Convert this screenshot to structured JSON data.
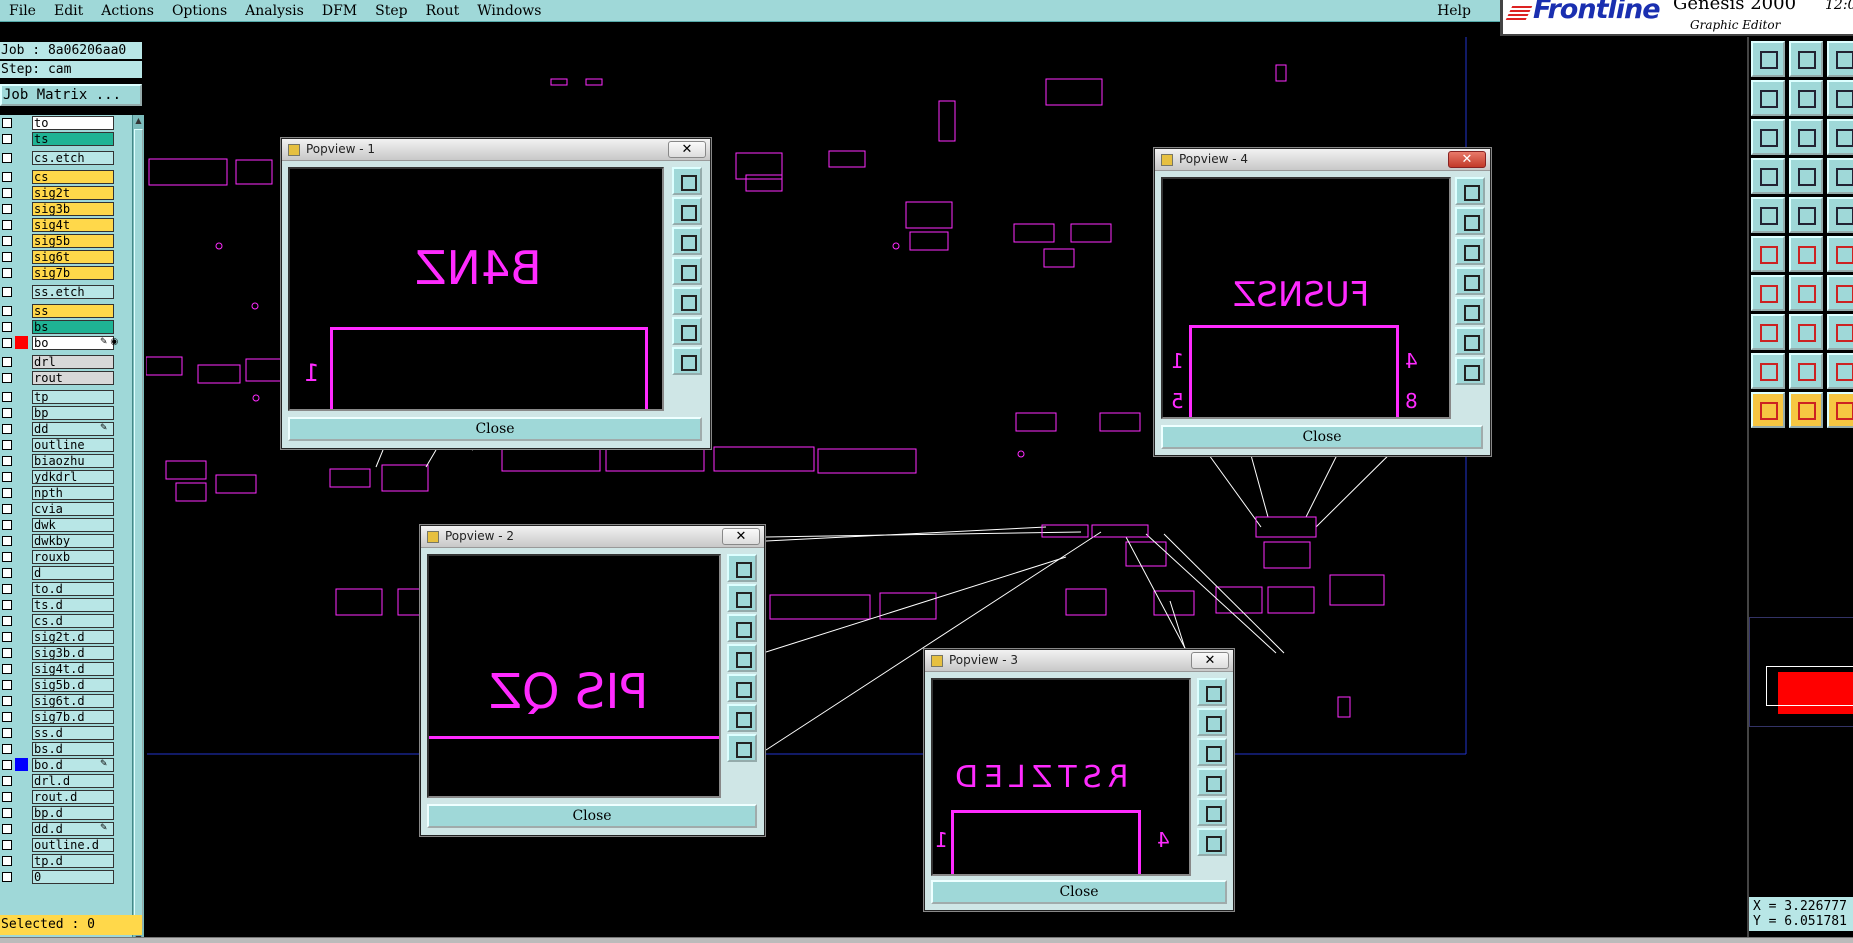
{
  "menu": {
    "items": [
      "File",
      "Edit",
      "Actions",
      "Options",
      "Analysis",
      "DFM",
      "Step",
      "Rout",
      "Windows"
    ],
    "help": "Help"
  },
  "logo": {
    "brand": "Frontline",
    "product": "Genesis 2000",
    "subtitle": "Graphic Editor",
    "time": "12:0"
  },
  "job": {
    "job_line": "Job : 8a06206aa0",
    "step_line": "Step: cam",
    "matrix_button": "Job Matrix ..."
  },
  "layers": [
    {
      "name": "to",
      "color": "#ffffff"
    },
    {
      "name": "ts",
      "color": "#1fb394"
    },
    {
      "name": "cs.etch",
      "color": "#b8e6e6"
    },
    {
      "name": "cs",
      "color": "#ffd84a"
    },
    {
      "name": "sig2t",
      "color": "#ffd84a"
    },
    {
      "name": "sig3b",
      "color": "#ffd84a"
    },
    {
      "name": "sig4t",
      "color": "#ffd84a"
    },
    {
      "name": "sig5b",
      "color": "#ffd84a"
    },
    {
      "name": "sig6t",
      "color": "#ffd84a"
    },
    {
      "name": "sig7b",
      "color": "#ffd84a"
    },
    {
      "name": "ss.etch",
      "color": "#b8e6e6"
    },
    {
      "name": "ss",
      "color": "#ffd84a"
    },
    {
      "name": "bs",
      "color": "#1fb394"
    },
    {
      "name": "bo",
      "color": "#ffffff",
      "swatch": "#ff0000",
      "icon": "✎ ◉"
    },
    {
      "name": "drl",
      "color": "#d8d8d8"
    },
    {
      "name": "rout",
      "color": "#d8d8d8"
    },
    {
      "name": "tp",
      "color": "#b8e6e6"
    },
    {
      "name": "bp",
      "color": "#b8e6e6"
    },
    {
      "name": "dd",
      "color": "#b8e6e6",
      "icon": "✎"
    },
    {
      "name": "outline",
      "color": "#b8e6e6"
    },
    {
      "name": "biaozhu",
      "color": "#b8e6e6"
    },
    {
      "name": "ydkdrl",
      "color": "#b8e6e6"
    },
    {
      "name": "npth",
      "color": "#b8e6e6"
    },
    {
      "name": "cvia",
      "color": "#b8e6e6"
    },
    {
      "name": "dwk",
      "color": "#b8e6e6"
    },
    {
      "name": "dwkby",
      "color": "#b8e6e6"
    },
    {
      "name": "rouxb",
      "color": "#b8e6e6"
    },
    {
      "name": "d",
      "color": "#b8e6e6"
    },
    {
      "name": "to.d",
      "color": "#b8e6e6"
    },
    {
      "name": "ts.d",
      "color": "#b8e6e6"
    },
    {
      "name": "cs.d",
      "color": "#b8e6e6"
    },
    {
      "name": "sig2t.d",
      "color": "#b8e6e6"
    },
    {
      "name": "sig3b.d",
      "color": "#b8e6e6"
    },
    {
      "name": "sig4t.d",
      "color": "#b8e6e6"
    },
    {
      "name": "sig5b.d",
      "color": "#b8e6e6"
    },
    {
      "name": "sig6t.d",
      "color": "#b8e6e6"
    },
    {
      "name": "sig7b.d",
      "color": "#b8e6e6"
    },
    {
      "name": "ss.d",
      "color": "#b8e6e6"
    },
    {
      "name": "bs.d",
      "color": "#b8e6e6"
    },
    {
      "name": "bo.d",
      "color": "#b8e6e6",
      "swatch": "#0000ff",
      "icon": "✎"
    },
    {
      "name": "drl.d",
      "color": "#b8e6e6"
    },
    {
      "name": "rout.d",
      "color": "#b8e6e6"
    },
    {
      "name": "bp.d",
      "color": "#b8e6e6"
    },
    {
      "name": "dd.d",
      "color": "#b8e6e6",
      "icon": "✎"
    },
    {
      "name": "outline.d",
      "color": "#b8e6e6"
    },
    {
      "name": "tp.d",
      "color": "#b8e6e6"
    },
    {
      "name": "0",
      "color": "#b8e6e6"
    }
  ],
  "selected": "Selected : 0",
  "coords": {
    "x": "X = 3.226777",
    "y": "Y = 6.051781"
  },
  "popviews": [
    {
      "title": "Popview - 1",
      "label": "B4NZ",
      "pins_left": "1",
      "pins_right": "",
      "pins_left2": "",
      "pins_right2": "",
      "close": "Close",
      "active": false
    },
    {
      "title": "Popview - 2",
      "label": "PIS QZ",
      "pins_left": "",
      "pins_right": "",
      "pins_left2": "",
      "pins_right2": "",
      "close": "Close",
      "active": false
    },
    {
      "title": "Popview - 3",
      "label": "RSTZLED",
      "pins_left": "1",
      "pins_right": "4",
      "pins_left2": "",
      "pins_right2": "",
      "close": "Close",
      "active": false
    },
    {
      "title": "Popview - 4",
      "label": "FUSNSZ",
      "pins_left": "1",
      "pins_right": "4",
      "pins_left2": "5",
      "pins_right2": "8",
      "close": "Close",
      "active": true
    }
  ],
  "colors": {
    "accent": "#9fd8d8",
    "board": "#ff2bff",
    "selected": "#ffd84a"
  }
}
